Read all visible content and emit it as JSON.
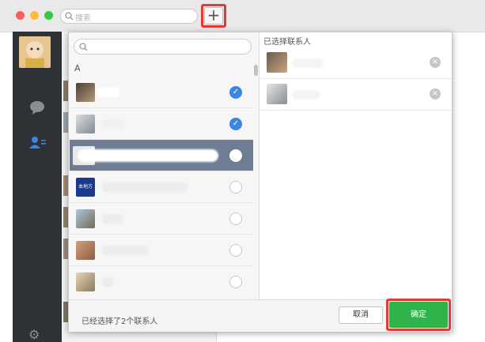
{
  "window": {
    "search_placeholder": "搜索",
    "plus_label": "+"
  },
  "sidebar": {
    "icons": [
      "chat-icon",
      "contacts-icon",
      "gear-icon"
    ]
  },
  "dialog": {
    "section_letter": "A",
    "selected_title": "已选择联系人",
    "contacts": [
      {
        "checked": true,
        "highlighted": false
      },
      {
        "checked": true,
        "highlighted": false
      },
      {
        "checked": false,
        "highlighted": true
      },
      {
        "checked": false,
        "highlighted": false,
        "avatar_text": "本地方"
      },
      {
        "checked": false,
        "highlighted": false
      },
      {
        "checked": false,
        "highlighted": false
      },
      {
        "checked": false,
        "highlighted": false
      }
    ],
    "footer_text": "已经选择了2个联系人",
    "cancel_label": "取消",
    "confirm_label": "确定"
  },
  "colors": {
    "accent_blue": "#3b86e3",
    "confirm_green": "#2fb44b",
    "highlight_red": "#e53935",
    "selected_row": "#6e7d93",
    "sidebar_dark": "#2e3136"
  }
}
